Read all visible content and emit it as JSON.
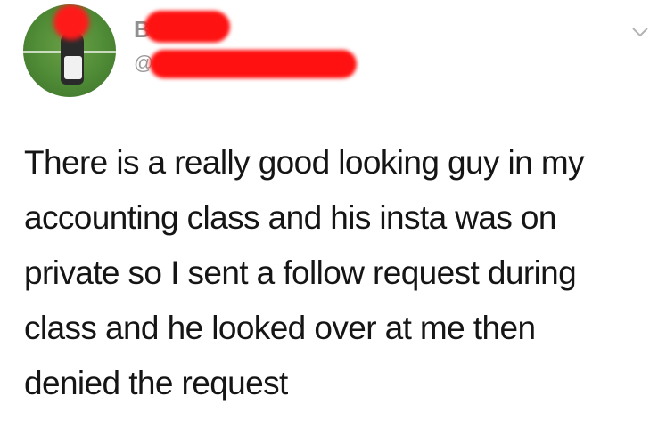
{
  "header": {
    "display_name": "BOh",
    "handle": "@",
    "menu_icon": "chevron-down-icon"
  },
  "tweet": {
    "lines": [
      "There is a really good looking guy in my",
      "accounting class and his insta was on",
      "private so I sent a follow request during",
      "class and he looked over at me then",
      "denied the request"
    ]
  },
  "colors": {
    "redaction": "#ff1212",
    "text": "#151515",
    "muted": "#9a9a9a"
  }
}
